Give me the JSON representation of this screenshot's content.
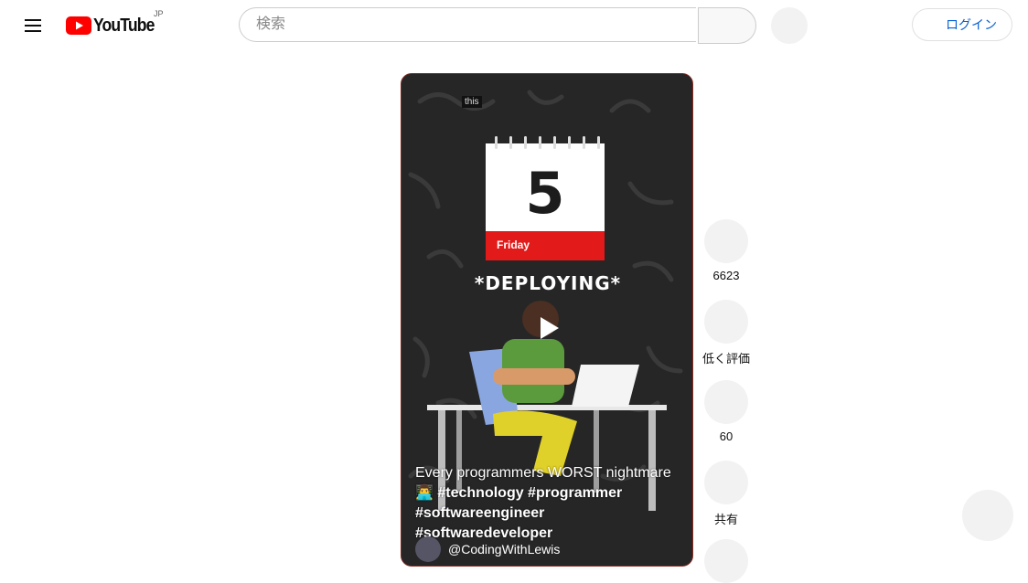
{
  "header": {
    "logo_text": "YouTube",
    "region_code": "JP",
    "search_placeholder": "検索",
    "login_label": "ログイン"
  },
  "short": {
    "overlay_caption": "this",
    "calendar_day": "5",
    "calendar_weekday": "Friday",
    "scene_text": "*DEPLOYING*",
    "title_line": "Every programmers WORST nightmare",
    "hashtags_line1": "#technology #programmer",
    "hashtags_line2": "#softwareengineer #softwaredeveloper",
    "channel_name": "@CodingWithLewis"
  },
  "actions": [
    {
      "name": "like",
      "label": "6623"
    },
    {
      "name": "dislike",
      "label": "低く評価"
    },
    {
      "name": "comments",
      "label": "60"
    },
    {
      "name": "share",
      "label": "共有"
    }
  ],
  "colors": {
    "brand_red": "#ff0000",
    "link_blue": "#065fd4",
    "calendar_red": "#e31a1a"
  }
}
